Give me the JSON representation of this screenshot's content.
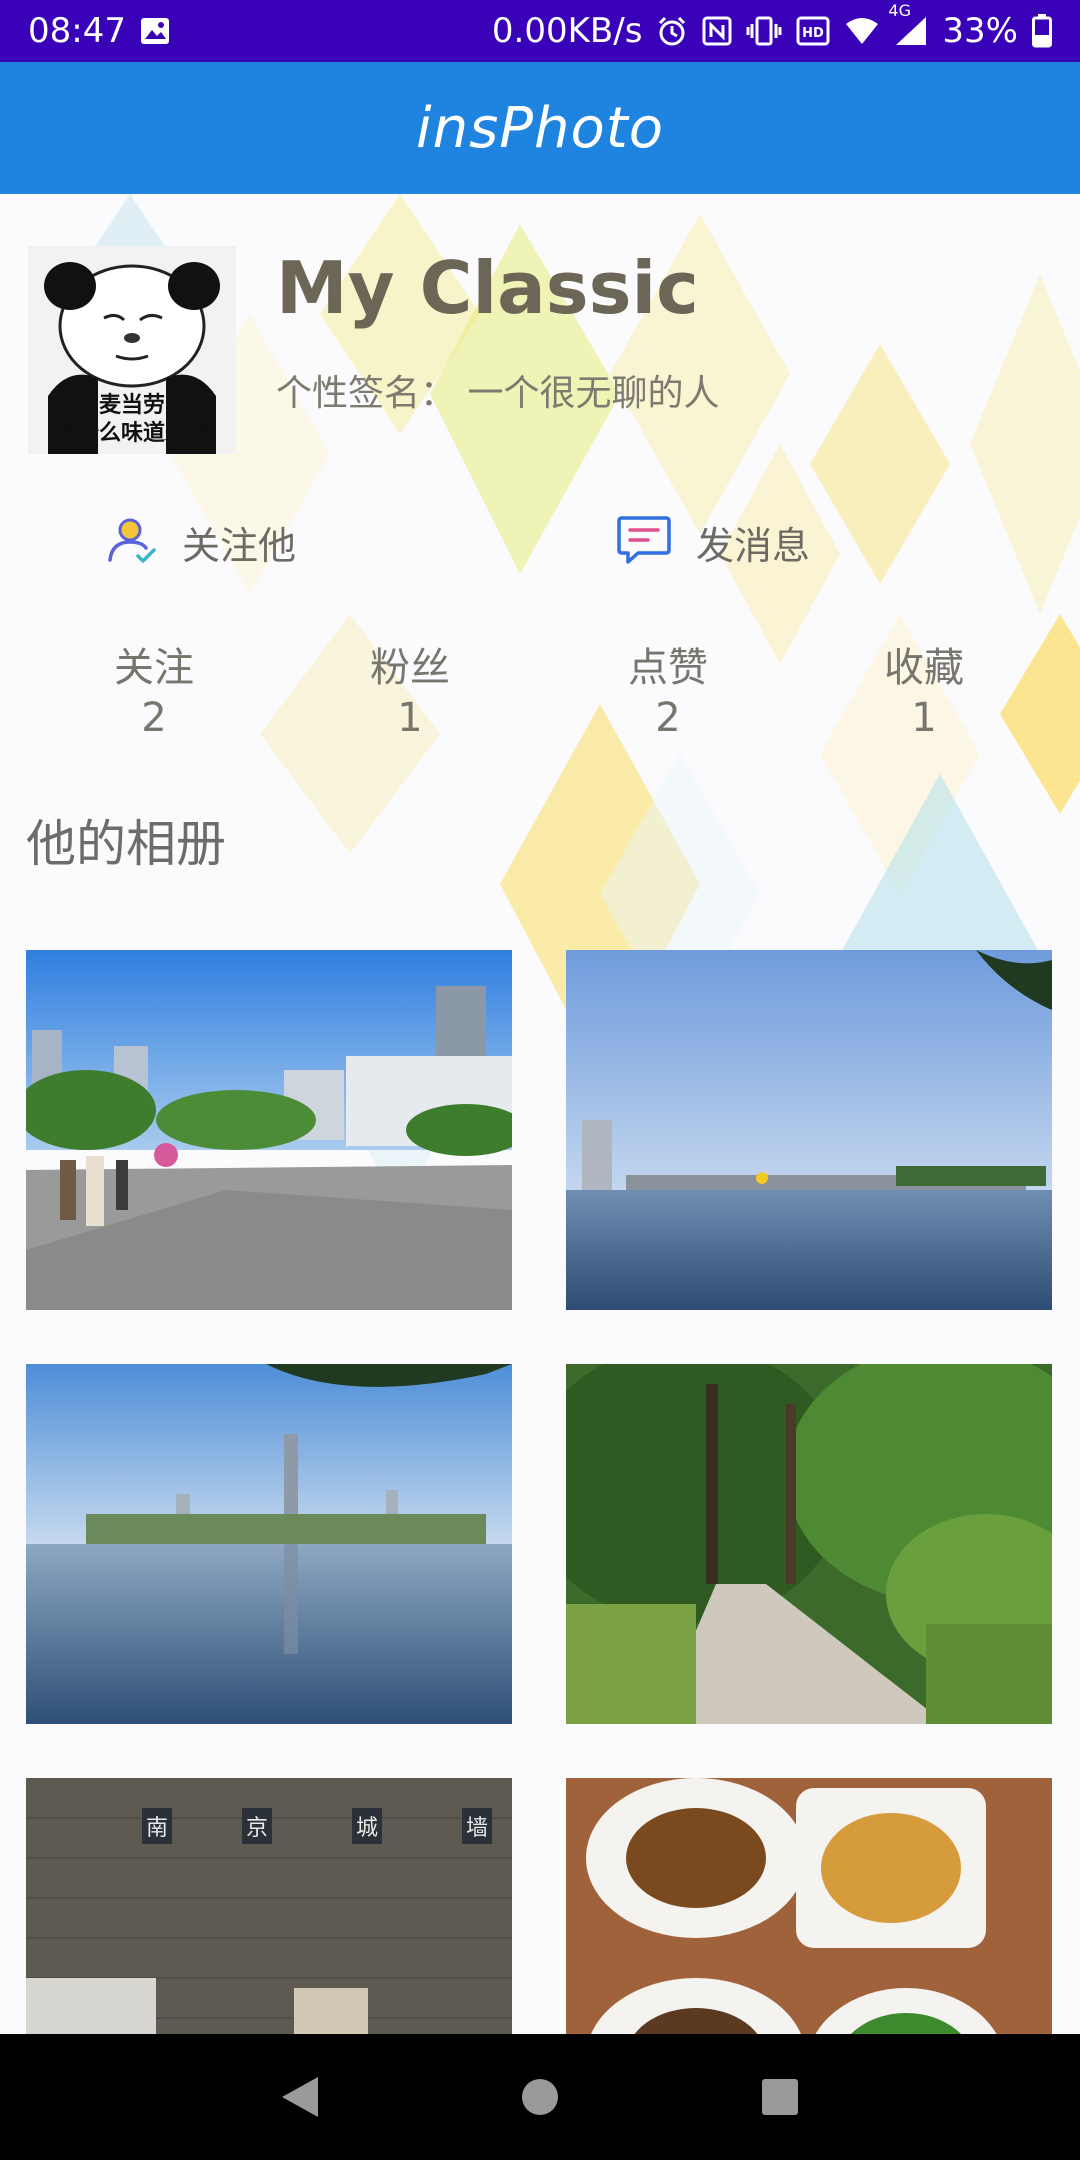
{
  "status_bar": {
    "time": "08:47",
    "net_speed": "0.00KB/s",
    "network": "4G",
    "battery": "33%",
    "icons": [
      "image-icon",
      "alarm-icon",
      "nfc-icon",
      "vibrate-icon",
      "hd-icon",
      "wifi-icon",
      "signal-icon",
      "battery-icon"
    ]
  },
  "app_bar": {
    "title": "insPhoto"
  },
  "profile": {
    "avatar_caption_line1": "麦当劳",
    "avatar_caption_line2": "是什么味道来着",
    "username": "My Classic",
    "signature": "个性签名：  一个很无聊的人"
  },
  "actions": {
    "follow_label": "关注他",
    "message_label": "发消息"
  },
  "stats": [
    {
      "label": "关注",
      "value": "2"
    },
    {
      "label": "粉丝",
      "value": "1"
    },
    {
      "label": "点赞",
      "value": "2"
    },
    {
      "label": "收藏",
      "value": "1"
    }
  ],
  "album": {
    "title": "他的相册",
    "photos": [
      "city-street-photo",
      "lake-skyline-photo",
      "lake-reflection-photo",
      "park-path-photo",
      "city-wall-photo",
      "dishes-photo"
    ]
  },
  "colors": {
    "status_bar": "#3a02b8",
    "app_bar": "#1f84e0",
    "nav_bar": "#000000"
  }
}
